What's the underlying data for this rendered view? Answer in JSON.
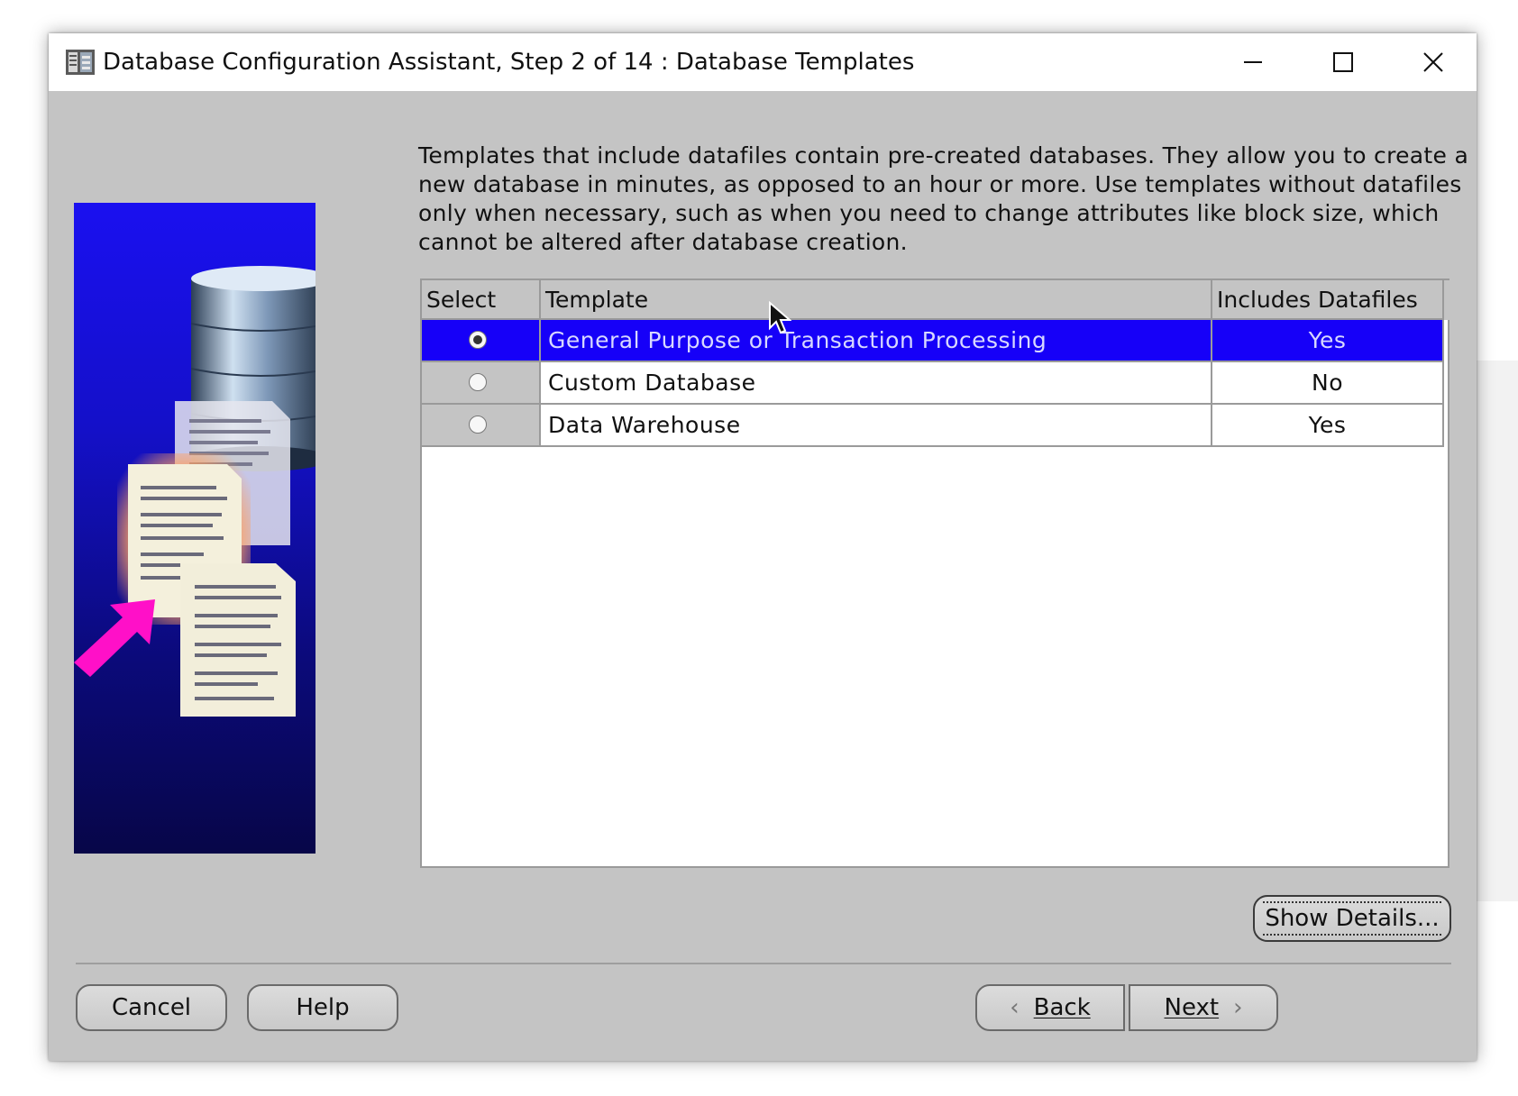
{
  "window": {
    "title": "Database Configuration Assistant, Step 2 of 14 : Database Templates"
  },
  "description": "Templates that include datafiles contain pre-created databases. They allow you to create a new database in minutes, as opposed to an hour or more. Use templates without datafiles only when necessary, such as when you need to change attributes like block size, which cannot be altered after database creation.",
  "table": {
    "headers": {
      "select": "Select",
      "template": "Template",
      "datafiles": "Includes Datafiles"
    },
    "rows": [
      {
        "template": "General Purpose or Transaction Processing",
        "datafiles": "Yes",
        "selected": true
      },
      {
        "template": "Custom Database",
        "datafiles": "No",
        "selected": false
      },
      {
        "template": "Data Warehouse",
        "datafiles": "Yes",
        "selected": false
      }
    ]
  },
  "buttons": {
    "show_details": "Show Details...",
    "cancel": "Cancel",
    "help": "Help",
    "back": "Back",
    "next": "Next"
  },
  "colors": {
    "selection": "#1600f8",
    "dialog_bg": "#c4c4c4"
  },
  "icons": {
    "title_icon": "database-app-icon",
    "minimize": "minimize-icon",
    "maximize": "maximize-icon",
    "close": "close-icon",
    "back": "chevron-left-icon",
    "next": "chevron-right-icon"
  }
}
